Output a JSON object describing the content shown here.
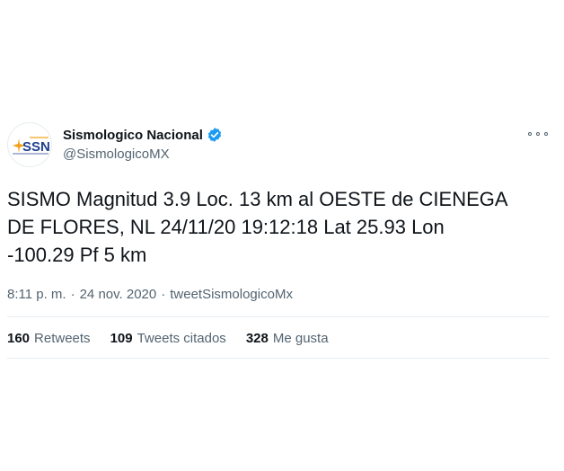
{
  "tweet": {
    "author": {
      "display_name": "Sismologico Nacional",
      "handle": "@SismologicoMX",
      "avatar_text": "SSN",
      "verified": true
    },
    "text": "SISMO Magnitud 3.9 Loc. 13 km al OESTE de CIENEGA\nDE FLORES, NL 24/11/20 19:12:18 Lat 25.93 Lon\n-100.29 Pf 5 km",
    "time": "8:11 p. m.",
    "separator": "·",
    "date": "24 nov. 2020",
    "source": "tweetSismologicoMx",
    "stats": [
      {
        "count": "160",
        "label": "Retweets"
      },
      {
        "count": "109",
        "label": "Tweets citados"
      },
      {
        "count": "328",
        "label": "Me gusta"
      }
    ]
  },
  "colors": {
    "text_primary": "#0f1419",
    "text_secondary": "#536471",
    "verified_blue": "#1d9bf0",
    "divider": "#e6ecf0",
    "ssn_blue": "#1f3f8f",
    "ssn_orange": "#f2a31b"
  },
  "icons": {
    "verified": "verified-badge-icon",
    "more": "more-options-icon"
  }
}
